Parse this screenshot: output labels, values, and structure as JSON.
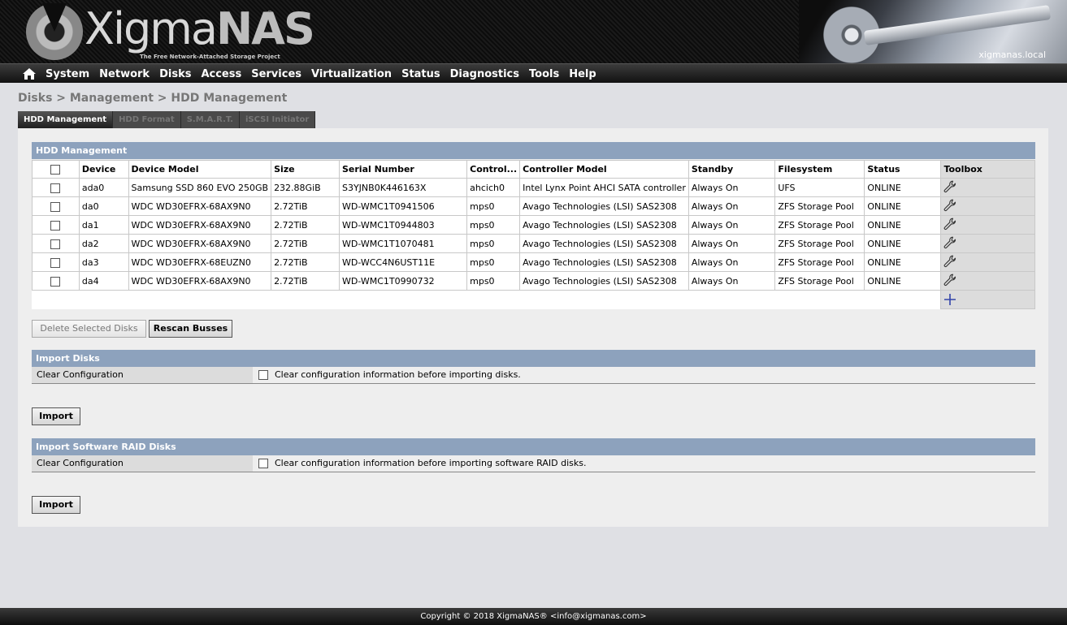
{
  "header": {
    "logo_text_light": "Xigma",
    "logo_text_bold": "NAS",
    "logo_tagline": "The Free Network-Attached Storage Project",
    "hostname": "xigmanas.local"
  },
  "nav": {
    "home_icon": "home-icon",
    "items": [
      "System",
      "Network",
      "Disks",
      "Access",
      "Services",
      "Virtualization",
      "Status",
      "Diagnostics",
      "Tools",
      "Help"
    ]
  },
  "breadcrumb": "Disks > Management > HDD Management",
  "tabs": [
    {
      "label": "HDD Management",
      "active": true
    },
    {
      "label": "HDD Format",
      "active": false
    },
    {
      "label": "S.M.A.R.T.",
      "active": false
    },
    {
      "label": "iSCSI Initiator",
      "active": false
    }
  ],
  "hdd_management": {
    "title": "HDD Management",
    "columns": [
      "",
      "Device",
      "Device Model",
      "Size",
      "Serial Number",
      "Control...",
      "Controller Model",
      "Standby",
      "Filesystem",
      "Status",
      "Toolbox"
    ],
    "rows": [
      {
        "device": "ada0",
        "model": "Samsung SSD 860 EVO 250GB",
        "size": "232.88GiB",
        "serial": "S3YJNB0K446163X",
        "controller": "ahcich0",
        "controller_model": "Intel Lynx Point AHCI SATA controller",
        "standby": "Always On",
        "filesystem": "UFS",
        "status": "ONLINE"
      },
      {
        "device": "da0",
        "model": "WDC WD30EFRX-68AX9N0",
        "size": "2.72TiB",
        "serial": "WD-WMC1T0941506",
        "controller": "mps0",
        "controller_model": "Avago Technologies (LSI) SAS2308",
        "standby": "Always On",
        "filesystem": "ZFS Storage Pool",
        "status": "ONLINE"
      },
      {
        "device": "da1",
        "model": "WDC WD30EFRX-68AX9N0",
        "size": "2.72TiB",
        "serial": "WD-WMC1T0944803",
        "controller": "mps0",
        "controller_model": "Avago Technologies (LSI) SAS2308",
        "standby": "Always On",
        "filesystem": "ZFS Storage Pool",
        "status": "ONLINE"
      },
      {
        "device": "da2",
        "model": "WDC WD30EFRX-68AX9N0",
        "size": "2.72TiB",
        "serial": "WD-WMC1T1070481",
        "controller": "mps0",
        "controller_model": "Avago Technologies (LSI) SAS2308",
        "standby": "Always On",
        "filesystem": "ZFS Storage Pool",
        "status": "ONLINE"
      },
      {
        "device": "da3",
        "model": "WDC WD30EFRX-68EUZN0",
        "size": "2.72TiB",
        "serial": "WD-WCC4N6UST11E",
        "controller": "mps0",
        "controller_model": "Avago Technologies (LSI) SAS2308",
        "standby": "Always On",
        "filesystem": "ZFS Storage Pool",
        "status": "ONLINE"
      },
      {
        "device": "da4",
        "model": "WDC WD30EFRX-68AX9N0",
        "size": "2.72TiB",
        "serial": "WD-WMC1T0990732",
        "controller": "mps0",
        "controller_model": "Avago Technologies (LSI) SAS2308",
        "standby": "Always On",
        "filesystem": "ZFS Storage Pool",
        "status": "ONLINE"
      }
    ],
    "row_tool_icon": "wrench-icon",
    "add_icon": "plus-icon"
  },
  "buttons": {
    "delete_selected": "Delete Selected Disks",
    "rescan": "Rescan Busses"
  },
  "import_disks": {
    "title": "Import Disks",
    "option_label": "Clear Configuration",
    "option_text": "Clear configuration information before importing disks.",
    "checked": false,
    "button": "Import"
  },
  "import_raid": {
    "title": "Import Software RAID Disks",
    "option_label": "Clear Configuration",
    "option_text": "Clear configuration information before importing software RAID disks.",
    "checked": false,
    "button": "Import"
  },
  "footer": "Copyright © 2018 XigmaNAS® <info@xigmanas.com>",
  "colors": {
    "section_header": "#8da2bd",
    "page_background": "#dfe0e4",
    "panel_background": "#eeeeee",
    "add_icon": "#3344aa"
  }
}
